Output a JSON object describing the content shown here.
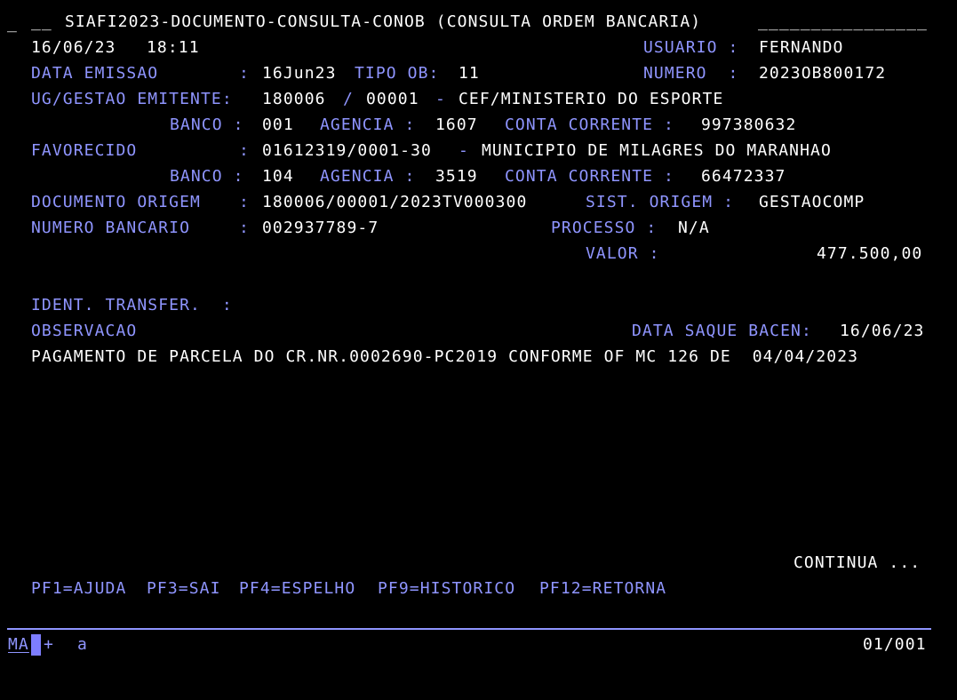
{
  "header": {
    "underscore": "_",
    "cmd_field": "__",
    "title": "SIAFI2023-DOCUMENTO-CONSULTA-CONOB (CONSULTA ORDEM BANCARIA)",
    "title_fill": "________________",
    "date": "16/06/23",
    "time": "18:11",
    "usuario_label": "USUARIO :",
    "usuario": "FERNANDO"
  },
  "fields": {
    "data_emissao_label": "DATA EMISSAO",
    "colon": ":",
    "data_emissao": "16Jun23",
    "tipo_ob_label": "TIPO OB:",
    "tipo_ob": "11",
    "numero_label": "NUMERO  :",
    "numero": "2023OB800172",
    "ug_label": "UG/GESTAO EMITENTE:",
    "ug": "180006",
    "slash": "/",
    "gestao": "00001",
    "dash": "-",
    "ug_nome": "CEF/MINISTERIO DO ESPORTE",
    "banco_label": "BANCO :",
    "banco1": "001",
    "agencia_label": "AGENCIA :",
    "agencia1": "1607",
    "conta_label": "CONTA CORRENTE :",
    "conta1": "997380632",
    "favorecido_label": "FAVORECIDO",
    "favorecido_cnpj": "01612319/0001-30",
    "favorecido_nome": "MUNICIPIO DE MILAGRES DO MARANHAO",
    "banco2": "104",
    "agencia2": "3519",
    "conta2": "66472337",
    "doc_origem_label": "DOCUMENTO ORIGEM",
    "doc_origem": "180006/00001/2023TV000300",
    "sist_origem_label": "SIST. ORIGEM :",
    "sist_origem": "GESTAOCOMP",
    "num_bancario_label": "NUMERO BANCARIO",
    "num_bancario": "002937789-7",
    "processo_label": "PROCESSO :",
    "processo": "N/A",
    "valor_label": "VALOR :",
    "valor": "477.500,00",
    "ident_label": "IDENT. TRANSFER.  :",
    "observacao_label": "OBSERVACAO",
    "data_saque_label": "DATA SAQUE BACEN:",
    "data_saque": "16/06/23",
    "observacao": "PAGAMENTO DE PARCELA DO CR.NR.0002690-PC2019 CONFORME OF MC 126 DE  04/04/2023"
  },
  "footer": {
    "continua": "CONTINUA ...",
    "pf1": "PF1=AJUDA",
    "pf3": "PF3=SAI",
    "pf4": "PF4=ESPELHO",
    "pf9": "PF9=HISTORICO",
    "pf12": "PF12=RETORNA"
  },
  "status": {
    "ma": "MA",
    "plus": "+",
    "a": "a",
    "page": "01/001"
  },
  "colors": {
    "foreground": "#ffffff",
    "label": "#8f95ff",
    "background": "#000000"
  }
}
